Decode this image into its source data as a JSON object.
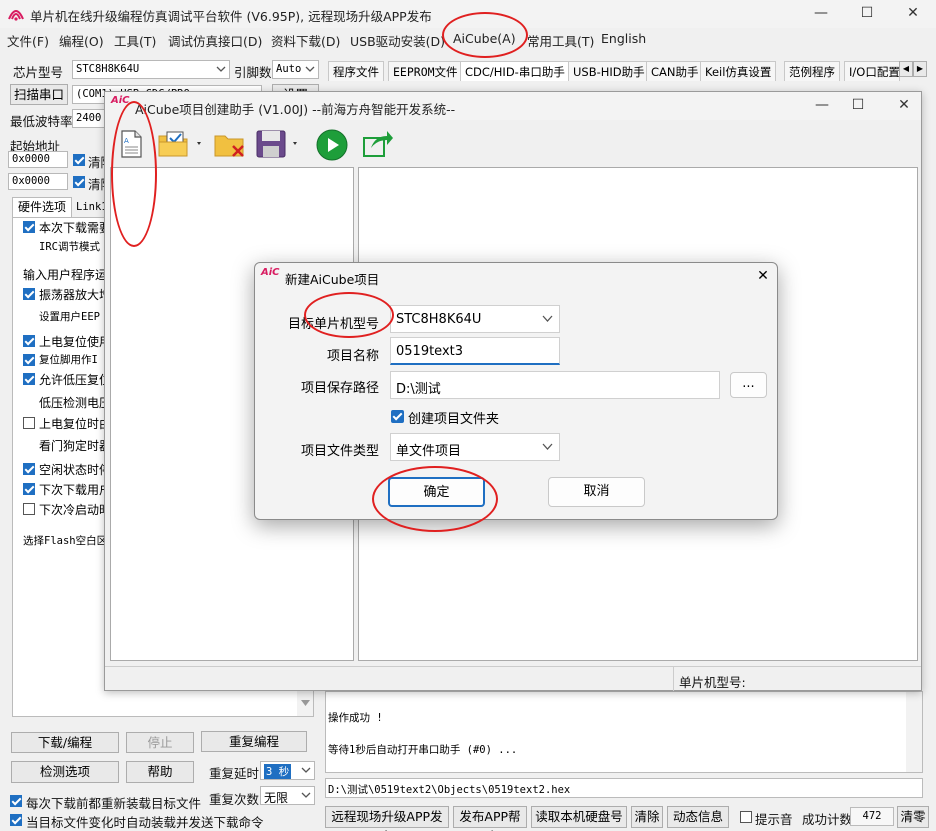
{
  "window": {
    "title": "单片机在线升级编程仿真调试平台软件 (V6.95P), 远程现场升级APP发布",
    "minimize": "—",
    "maximize": "☐",
    "close": "✕"
  },
  "menu": [
    "文件(F)",
    "编程(O)",
    "工具(T)",
    "调试仿真接口(D)",
    "资料下载(D)",
    "USB驱动安装(D)",
    "AiCube(A)",
    "常用工具(T)",
    "English"
  ],
  "left": {
    "chip_label": "芯片型号",
    "chip_value": "STC8H8K64U",
    "pin_label": "引脚数",
    "pin_value": "Auto",
    "scan_label": "扫描串口",
    "port_value": "(COM1) USB-CDC/PRO",
    "settings_label": "设置",
    "baud_label": "最低波特率",
    "baud_value": "2400",
    "start_addr_label": "起始地址",
    "addr1": "0x0000",
    "addr2": "0x0000",
    "clear1": "清除",
    "clear2": "清除",
    "hw_tab": "硬件选项",
    "link_tab": "Link1",
    "options": [
      {
        "text": "本次下载需要",
        "checked": true
      },
      {
        "text": "IRC调节模式",
        "checked": null
      },
      {
        "text": "输入用户程序运",
        "checked": null
      },
      {
        "text": "振荡器放大增",
        "checked": true
      },
      {
        "text": "设置用户EEP",
        "checked": null
      },
      {
        "text": "上电复位使用",
        "checked": true
      },
      {
        "text": "复位脚用作I",
        "checked": true
      },
      {
        "text": "允许低压复位",
        "checked": true
      },
      {
        "text": "低压检测电压",
        "checked": null
      },
      {
        "text": "上电复位时由",
        "checked": false
      },
      {
        "text": "看门狗定时器",
        "checked": null
      },
      {
        "text": "空闲状态时停",
        "checked": true
      },
      {
        "text": "下次下载用户",
        "checked": true
      },
      {
        "text": "下次冷启动时",
        "checked": false
      },
      {
        "text": "选择Flash空白区",
        "checked": null
      }
    ],
    "download_btn": "下载/编程",
    "stop_btn": "停止",
    "reprogram_btn": "重复编程",
    "detect_btn": "检测选项",
    "help_btn": "帮助",
    "delay_label": "重复延时",
    "delay_value": "3 秒",
    "count_label": "重复次数",
    "count_value": "无限",
    "reload_text": "每次下载前都重新装载目标文件",
    "autoload_text": "当目标文件变化时自动装载并发送下载命令"
  },
  "tabs": [
    "程序文件",
    "EEPROM文件",
    "CDC/HID-串口助手",
    "USB-HID助手",
    "CAN助手",
    "Keil仿真设置",
    "范例程序",
    "I/O口配置"
  ],
  "log": {
    "line1": "操作成功 !",
    "line2": "等待1秒后自动打开串口助手 (#0) ...",
    "path": "D:\\测试\\0519text2\\Objects\\0519text2.hex"
  },
  "bottom": {
    "publish_btn": "远程现场升级APP发布",
    "publish_help_btn": "发布APP帮助",
    "read_disk_btn": "读取本机硬盘号",
    "clear_btn": "清除",
    "dynamic_btn": "动态信息",
    "beep_label": "提示音",
    "success_label": "成功计数",
    "success_value": "472",
    "clear_count_btn": "清零"
  },
  "aicube": {
    "title": "AiCube项目创建助手 (V1.00J) --前海方舟智能开发系统--",
    "logo": "AiC",
    "status_label": "单片机型号:"
  },
  "dialog": {
    "logo": "AiC",
    "title": "新建AiCube项目",
    "close": "✕",
    "target_label": "目标单片机型号",
    "target_value": "STC8H8K64U",
    "name_label": "项目名称",
    "name_value": "0519text3",
    "path_label": "项目保存路径",
    "path_value": "D:\\测试",
    "browse": "...",
    "create_folder": "创建项目文件夹",
    "type_label": "项目文件类型",
    "type_value": "单文件项目",
    "ok": "确定",
    "cancel": "取消"
  },
  "colors": {
    "accent": "#1f6fc2",
    "annotation_red": "#e02020",
    "play_green": "#1e9e3a"
  }
}
